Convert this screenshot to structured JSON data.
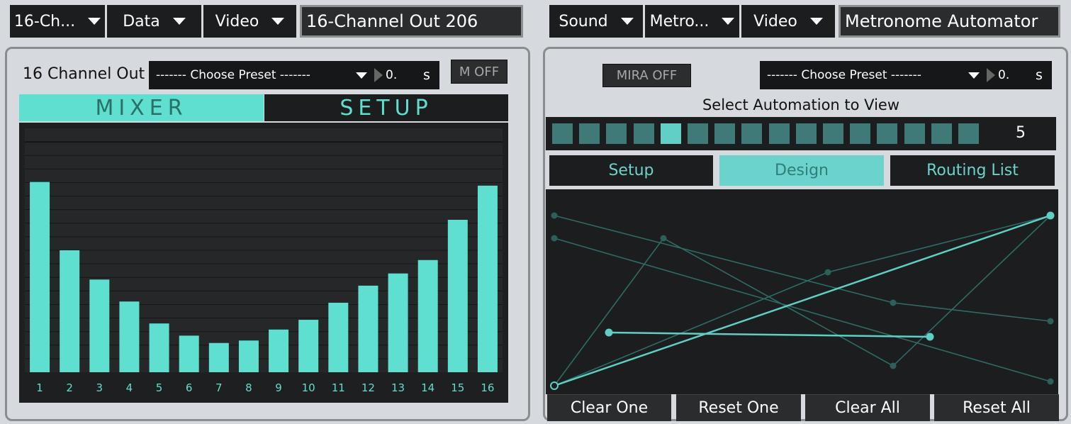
{
  "left_toolbar": {
    "dropdowns": [
      "16-Ch...",
      "Data",
      "Video"
    ],
    "name": "16-Channel Out 206"
  },
  "right_toolbar": {
    "dropdowns": [
      "Sound",
      "Metro...",
      "Video"
    ],
    "name": "Metronome Automator"
  },
  "left_panel": {
    "title": "16 Channel Out",
    "preset_label": "------- Choose Preset -------",
    "preset_value": "0.",
    "preset_unit": "s",
    "mute_label": "M OFF",
    "tabs": [
      "MIXER",
      "SETUP"
    ],
    "active_tab": 0,
    "mixer": {
      "channels": [
        "1",
        "2",
        "3",
        "4",
        "5",
        "6",
        "7",
        "8",
        "9",
        "10",
        "11",
        "12",
        "13",
        "14",
        "15",
        "16"
      ],
      "levels": [
        0.78,
        0.5,
        0.38,
        0.29,
        0.2,
        0.15,
        0.12,
        0.13,
        0.175,
        0.215,
        0.285,
        0.355,
        0.405,
        0.46,
        0.625,
        0.765
      ]
    }
  },
  "right_panel": {
    "mira_label": "MIRA OFF",
    "preset_label": "------- Choose Preset -------",
    "preset_value": "0.",
    "preset_unit": "s",
    "automation_title": "Select Automation to View",
    "automation_count": 16,
    "automation_selected": 4,
    "automation_value": "5",
    "tabs": [
      "Setup",
      "Design",
      "Routing List"
    ],
    "active_tab": 1,
    "buttons": [
      "Clear One",
      "Reset One",
      "Clear All",
      "Reset All"
    ]
  },
  "colors": {
    "accent": "#5fdfcf",
    "accent_dim": "#3f7a78",
    "dark": "#1b1d1e",
    "panel_bg": "#d6d9dd"
  },
  "icons": {
    "dropdown": "chevron-down-icon",
    "play": "play-triangle-icon"
  }
}
